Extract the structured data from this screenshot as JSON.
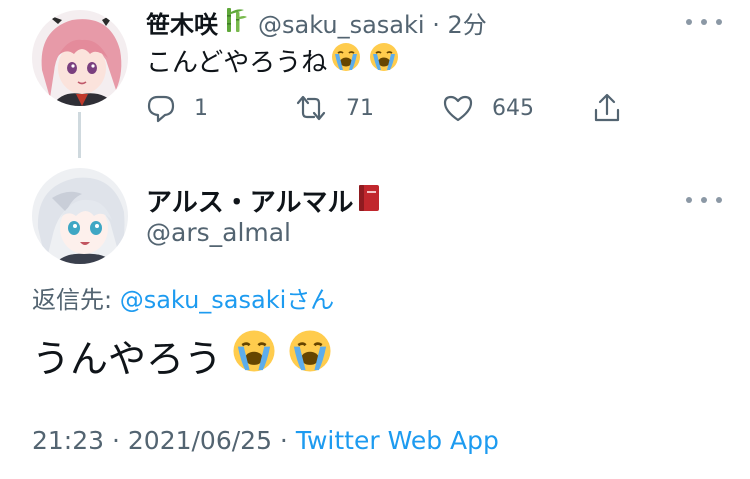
{
  "parent_tweet": {
    "display_name": "笹木咲",
    "name_badge_icon": "bamboo-icon",
    "handle": "@saku_sasaki",
    "separator": "·",
    "time_ago": "2分",
    "text": "こんどやろうね",
    "text_emojis": [
      "loudly-crying-face",
      "loudly-crying-face"
    ],
    "actions": {
      "reply_count": "1",
      "retweet_count": "71",
      "like_count": "645"
    }
  },
  "reply_tweet": {
    "display_name": "アルス・アルマル",
    "name_badge_icon": "red-book-icon",
    "handle": "@ars_almal",
    "replying_to_label": "返信先: ",
    "replying_to_handle": "@saku_sasaki",
    "replying_to_suffix": "さん",
    "text": "うんやろう",
    "text_emojis": [
      "loudly-crying-face",
      "loudly-crying-face"
    ],
    "time": "21:23",
    "date": "2021/06/25",
    "source": "Twitter Web App",
    "meta_separator": " · "
  },
  "colors": {
    "link": "#1d9bf0",
    "secondary_text": "#536471",
    "primary_text": "#0f1419",
    "thread_line": "#cfd9de"
  }
}
